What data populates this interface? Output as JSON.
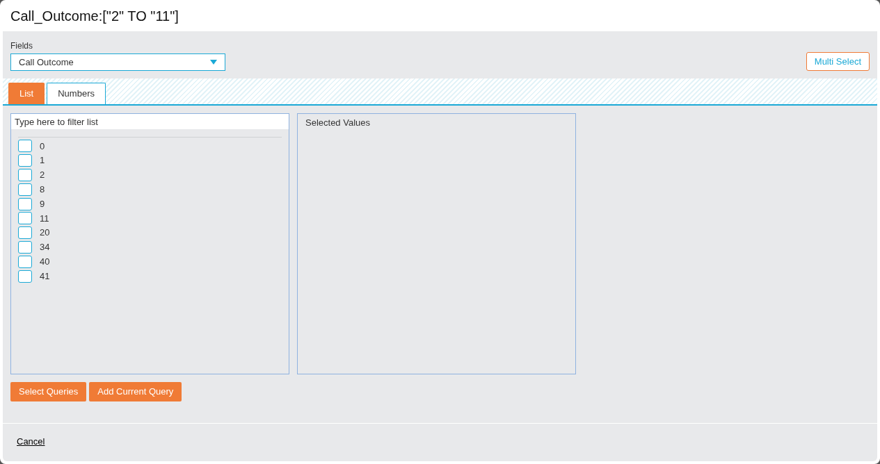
{
  "window": {
    "title": "Call_Outcome:[\"2\" TO \"11\"]"
  },
  "fields": {
    "label": "Fields",
    "value": "Call Outcome"
  },
  "multi_select_button": "Multi Select",
  "tabs": [
    {
      "label": "List",
      "selected": true
    },
    {
      "label": "Numbers",
      "selected": false
    }
  ],
  "filter": {
    "placeholder": "Type here to filter list"
  },
  "items": [
    {
      "label": "0",
      "checked": false
    },
    {
      "label": "1",
      "checked": false
    },
    {
      "label": "2",
      "checked": false
    },
    {
      "label": "8",
      "checked": false
    },
    {
      "label": "9",
      "checked": false
    },
    {
      "label": "11",
      "checked": false
    },
    {
      "label": "20",
      "checked": false
    },
    {
      "label": "34",
      "checked": false
    },
    {
      "label": "40",
      "checked": false
    },
    {
      "label": "41",
      "checked": false
    }
  ],
  "selected_values": {
    "title": "Selected Values"
  },
  "actions": [
    "Select Queries",
    "Add Current Query"
  ],
  "cancel": "Cancel"
}
